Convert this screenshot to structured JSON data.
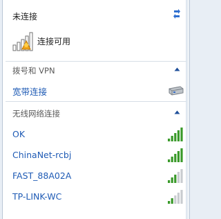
{
  "status": {
    "title": "未连接",
    "available_label": "连接可用"
  },
  "dialup": {
    "header": "拨号和 VPN",
    "items": [
      {
        "label": "宽带连接"
      }
    ]
  },
  "wireless": {
    "header": "无线网络连接",
    "networks": [
      {
        "label": "OK",
        "signal_bars": 5
      },
      {
        "label": "ChinaNet-rcbj",
        "signal_bars": 5
      },
      {
        "label": "FAST_88A02A",
        "signal_bars": 3
      },
      {
        "label": "TP-LINK-WC",
        "signal_bars": 2
      }
    ]
  },
  "colors": {
    "link": "#1f5bb5",
    "signal_on": "#3a9a2a",
    "signal_off": "#c9ccd0"
  },
  "icons": {
    "refresh": "refresh-icon",
    "available": "network-available-icon",
    "collapse": "chevron-up-icon",
    "broadband": "broadband-drive-icon",
    "signal": "wifi-signal-icon"
  }
}
